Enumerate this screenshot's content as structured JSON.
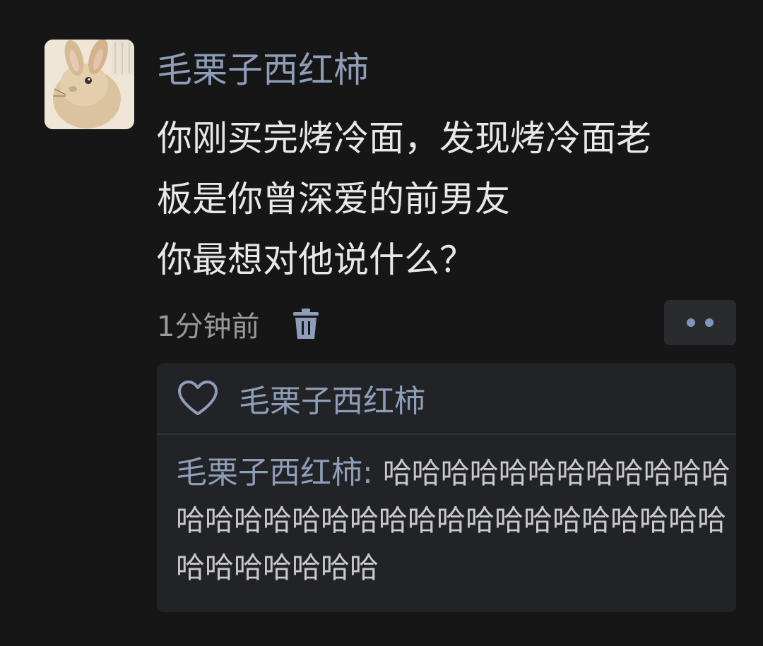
{
  "post": {
    "author": "毛栗子西红柿",
    "avatar_icon": "rabbit-photo-avatar",
    "lines": [
      "你刚买完烤冷面，发现烤冷面老",
      "板是你曾深爱的前男友",
      "你最想对他说什么？"
    ],
    "timestamp": "1分钟前",
    "delete_icon": "trash-icon",
    "more_icon": "more-dots-icon"
  },
  "interactions": {
    "like_icon": "heart-outline-icon",
    "liked_by": "毛栗子西红柿",
    "comment": {
      "author": "毛栗子西红柿",
      "separator": ": ",
      "text": "哈哈哈哈哈哈哈哈哈哈哈哈哈哈哈哈哈哈哈哈哈哈哈哈哈哈哈哈哈哈哈哈哈哈哈哈哈哈"
    }
  },
  "colors": {
    "background": "#161616",
    "accent_name": "#8e9db8",
    "panel": "#222326"
  }
}
